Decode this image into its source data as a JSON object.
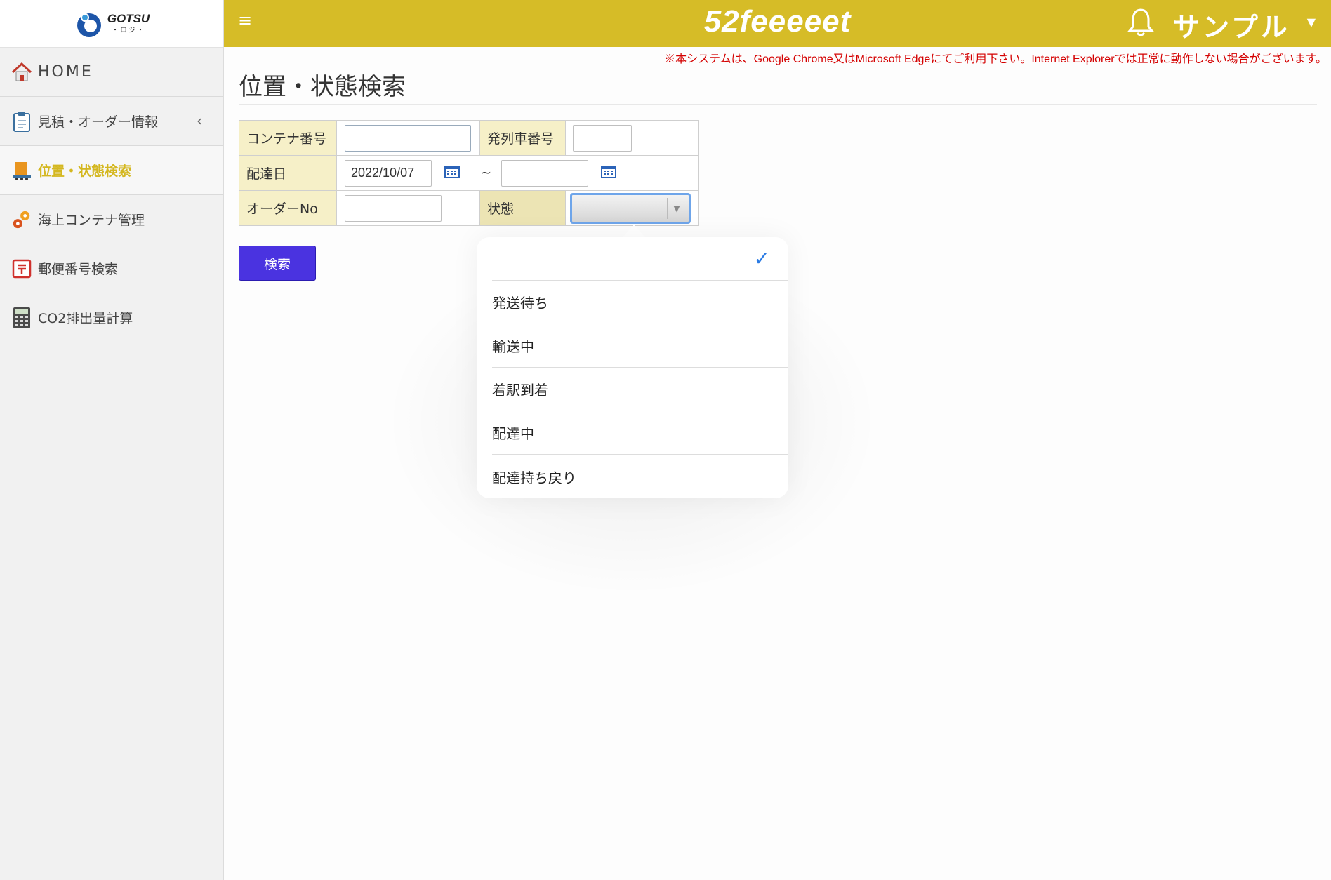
{
  "app": {
    "brand": "52feeeeet",
    "logo_text": "GOTSU",
    "logo_sub": "・ロジ・"
  },
  "header": {
    "menu_icon": "hamburger-icon",
    "user_name": "サンプル"
  },
  "notice": "※本システムは、Google Chrome又はMicrosoft Edgeにてご利用下さい。Internet Explorerでは正常に動作しない場合がございます。",
  "sidebar": {
    "items": [
      {
        "label": "HOME",
        "icon": "home-icon"
      },
      {
        "label": "見積・オーダー情報",
        "icon": "clipboard-icon",
        "caret": "‹"
      },
      {
        "label": "位置・状態検索",
        "icon": "container-truck-icon",
        "active": true
      },
      {
        "label": "海上コンテナ管理",
        "icon": "gears-icon"
      },
      {
        "label": "郵便番号検索",
        "icon": "postal-icon"
      },
      {
        "label": "CO2排出量計算",
        "icon": "calculator-icon"
      }
    ]
  },
  "page": {
    "title": "位置・状態検索",
    "form": {
      "container_no_label": "コンテナ番号",
      "container_no_value": "",
      "train_no_label": "発列車番号",
      "train_no_value": "",
      "delivery_date_label": "配達日",
      "date_from": "2022/10/07",
      "date_sep": "~",
      "date_to": "",
      "order_no_label": "オーダーNo",
      "order_no_value": "",
      "status_label": "状態",
      "status_value": ""
    },
    "search_button": "検索"
  },
  "status_dropdown": {
    "options": [
      "",
      "発送待ち",
      "輸送中",
      "着駅到着",
      "配達中",
      "配達持ち戻り"
    ],
    "selected_index": 0,
    "check_glyph": "✓"
  },
  "colors": {
    "header": "#d6bc27",
    "accent": "#d4b71f",
    "button": "#4a33e0",
    "label_bg": "#f6f0c8",
    "notice": "#d40000"
  }
}
